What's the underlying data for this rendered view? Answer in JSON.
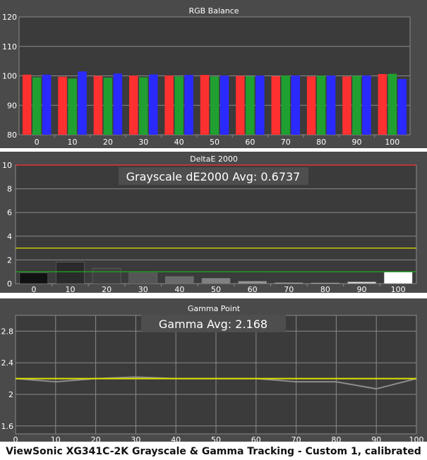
{
  "caption": "ViewSonic XG341C-2K Grayscale & Gamma Tracking - Custom 1, calibrated",
  "colors": {
    "background": "#4a4a4a",
    "plot_background": "#3b3b3b",
    "grid": "#8a8a8a",
    "text": "#ffffff",
    "red": "#ff3030",
    "green": "#20a030",
    "blue": "#2a2aff",
    "deltae_limit_red": "#ff3030",
    "deltae_threshold_yellow": "#e0e000",
    "deltae_threshold_green": "#20a020",
    "gamma_target": "#e0e000",
    "gamma_measured": "#8c8c8c",
    "annotation_box": "#4e4e4e"
  },
  "chart_data": [
    {
      "type": "bar",
      "title": "RGB Balance",
      "categories": [
        "0",
        "10",
        "20",
        "30",
        "40",
        "50",
        "60",
        "70",
        "80",
        "90",
        "100"
      ],
      "ylim": [
        80,
        120
      ],
      "yticks": [
        "80",
        "90",
        "100",
        "110",
        "120"
      ],
      "grid": true,
      "series": [
        {
          "color": "red",
          "values": [
            100.4,
            99.7,
            100.0,
            100.1,
            100.1,
            100.3,
            100.0,
            99.9,
            99.8,
            99.8,
            100.6
          ]
        },
        {
          "color": "green",
          "values": [
            99.5,
            99.1,
            99.4,
            99.5,
            99.8,
            99.8,
            99.9,
            100.1,
            100.1,
            100.0,
            100.7
          ]
        },
        {
          "color": "blue",
          "values": [
            100.4,
            101.5,
            100.8,
            100.5,
            100.3,
            100.1,
            100.1,
            100.1,
            100.1,
            100.1,
            98.9
          ]
        }
      ]
    },
    {
      "type": "bar",
      "title": "DeltaE 2000",
      "annotation": "Grayscale dE2000 Avg: 0.6737",
      "categories": [
        "0",
        "10",
        "20",
        "30",
        "40",
        "50",
        "60",
        "70",
        "80",
        "90",
        "100"
      ],
      "values": [
        0.9,
        1.8,
        1.3,
        0.9,
        0.6,
        0.45,
        0.2,
        0.08,
        0.06,
        0.15,
        1.0
      ],
      "bar_shades": [
        "#111111",
        "#2a2a2a",
        "#3f3f3f",
        "#555555",
        "#6b6b6b",
        "#818181",
        "#979797",
        "#adadad",
        "#c3c3c3",
        "#d9d9d9",
        "#ffffff"
      ],
      "ylim": [
        0,
        10
      ],
      "yticks": [
        "0",
        "2",
        "4",
        "6",
        "8",
        "10"
      ],
      "reference_lines": [
        {
          "value": 10,
          "color": "deltae_limit_red"
        },
        {
          "value": 3,
          "color": "deltae_threshold_yellow"
        },
        {
          "value": 1,
          "color": "deltae_threshold_green"
        }
      ],
      "grid": true
    },
    {
      "type": "line",
      "title": "Gamma Point",
      "annotation": "Gamma Avg: 2.168",
      "x": [
        0,
        10,
        20,
        30,
        40,
        50,
        60,
        70,
        80,
        90,
        100
      ],
      "xticks": [
        "0",
        "10",
        "20",
        "30",
        "40",
        "50",
        "60",
        "70",
        "80",
        "90",
        "100"
      ],
      "xlim": [
        0,
        100
      ],
      "ylim": [
        1.5,
        3.0
      ],
      "yticks": [
        "1.6",
        "2",
        "2.4",
        "2.8"
      ],
      "ytick_values": [
        1.6,
        2.0,
        2.4,
        2.8
      ],
      "series": [
        {
          "color": "gamma_target",
          "values": [
            2.2,
            2.2,
            2.2,
            2.2,
            2.2,
            2.2,
            2.2,
            2.2,
            2.2,
            2.2,
            2.2
          ]
        },
        {
          "color": "gamma_measured",
          "values": [
            2.2,
            2.16,
            2.2,
            2.22,
            2.2,
            2.2,
            2.2,
            2.16,
            2.16,
            2.07,
            2.2
          ]
        }
      ],
      "grid": true
    }
  ]
}
